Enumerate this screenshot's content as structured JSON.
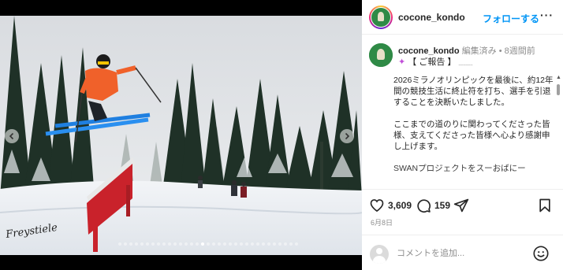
{
  "post": {
    "username": "cocone_kondo",
    "follow_label": "フォローする",
    "more_label": "···",
    "edited_label": "編集済み",
    "separator": "•",
    "time_ago": "8週間前",
    "caption_headline": "【 ご報告 】",
    "caption_paragraphs": [
      "2026ミラノオリンピックを最後に、約12年間の競技生活に終止符を打ち、選手を引退することを決断いたしました。",
      "ここまでの道のりに関わってくださった皆様、支えてくださった皆様へ心より感謝申し上げます。",
      "SWANプロジェクトをスーおばにー"
    ],
    "likes": "3,609",
    "comments": "159",
    "date": "6月8日",
    "comment_placeholder": "コメントを追加...",
    "photo_watermark": "Freystiele"
  },
  "icons": {
    "like": "heart-icon",
    "comment": "comment-bubble-icon",
    "share": "paper-plane-icon",
    "save": "bookmark-icon",
    "emoji": "smiley-face-icon",
    "prev": "chevron-left-icon",
    "next": "chevron-right-icon"
  },
  "colors": {
    "accent": "#0095f6",
    "text": "#262626",
    "muted": "#8e8e8e"
  }
}
